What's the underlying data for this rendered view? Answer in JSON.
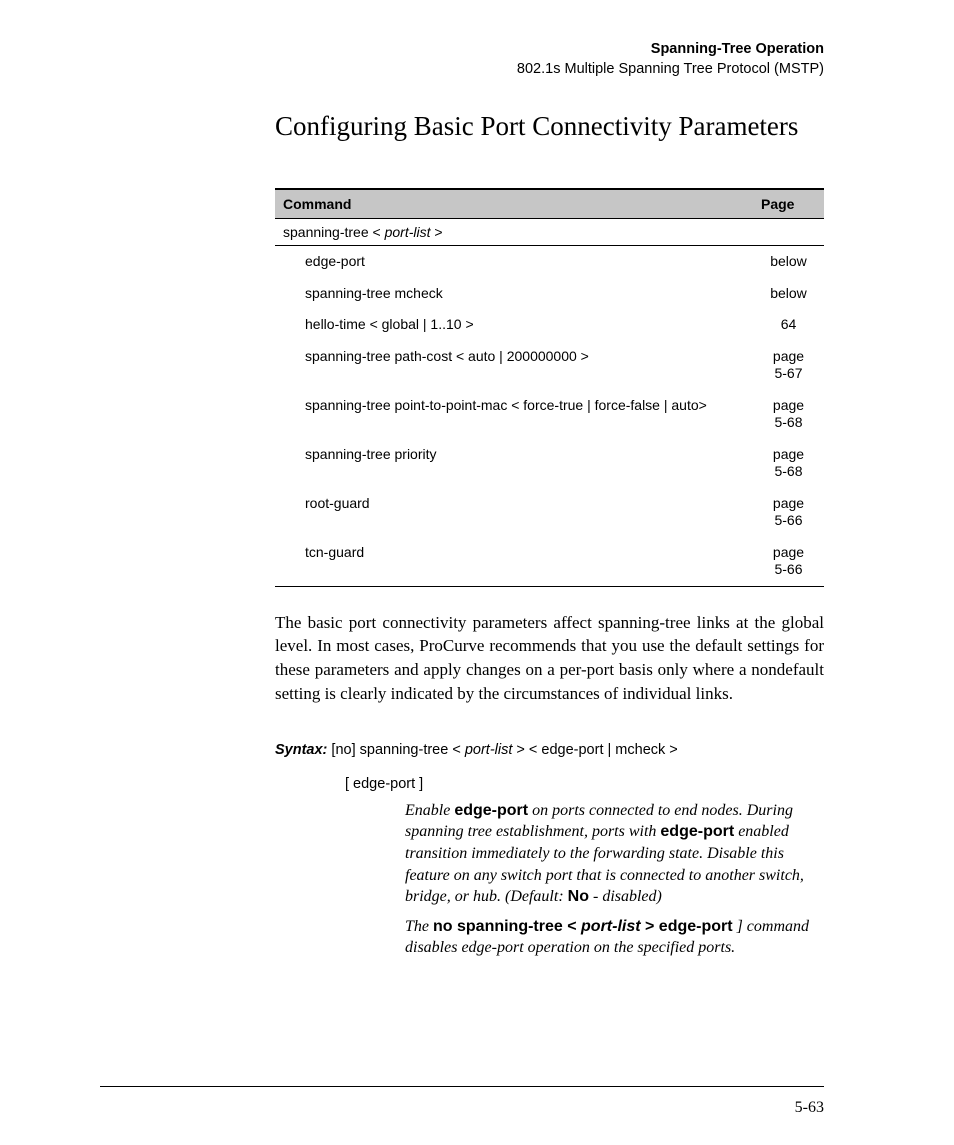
{
  "runhead": {
    "line1": "Spanning-Tree Operation",
    "line2": "802.1s Multiple Spanning Tree Protocol (MSTP)"
  },
  "heading": "Configuring Basic Port Connectivity Parameters",
  "table": {
    "head_command": "Command",
    "head_page": "Page",
    "top_command_prefix": "spanning-tree < ",
    "top_command_ital": "port-list",
    "top_command_suffix": " >",
    "rows": [
      {
        "cmd": "edge-port",
        "page": "below"
      },
      {
        "cmd": "spanning-tree mcheck",
        "page": "below"
      },
      {
        "cmd": "hello-time < global | 1..10 >",
        "page": "64"
      },
      {
        "cmd": "spanning-tree path-cost < auto | 200000000 >",
        "page": "page\n5-67"
      },
      {
        "cmd": "spanning-tree point-to-point-mac < force-true | force-false | auto>",
        "page": "page\n5-68"
      },
      {
        "cmd": "spanning-tree priority",
        "page": "page\n5-68"
      },
      {
        "cmd": "root-guard",
        "page": "page\n5-66"
      },
      {
        "cmd": "tcn-guard",
        "page": "page\n5-66"
      }
    ]
  },
  "paragraph": "The basic port connectivity parameters affect spanning-tree links at the global level. In most cases, ProCurve recommends that you use the default settings for these parameters and apply changes on a per-port basis only where a nondefault setting is clearly indicated by the circumstances of individual links.",
  "syntax": {
    "label": "Syntax:",
    "line_prefix": "  [no] spanning-tree < ",
    "line_ital": "port-list",
    "line_suffix": " > < edge-port | mcheck >",
    "sub": "[ edge-port ]"
  },
  "desc": {
    "p1_a": "Enable ",
    "p1_b1": "edge-port",
    "p1_b": " on ports connected to end nodes. During spanning tree establishment, ports with ",
    "p1_b2": "edge-port",
    "p1_c": " enabled transition immediately to the forwarding state. Disable this feature on any switch port that is connected to another switch, bridge, or hub. (Default: ",
    "p1_b3": "No",
    "p1_d": " - disabled)",
    "p2_a": "The ",
    "p2_b1": "no spanning-tree < ",
    "p2_bi": "port-list",
    "p2_b2": " > edge-port",
    "p2_b": " ] command disables edge-port operation on the specified ports."
  },
  "pagenum": "5-63"
}
